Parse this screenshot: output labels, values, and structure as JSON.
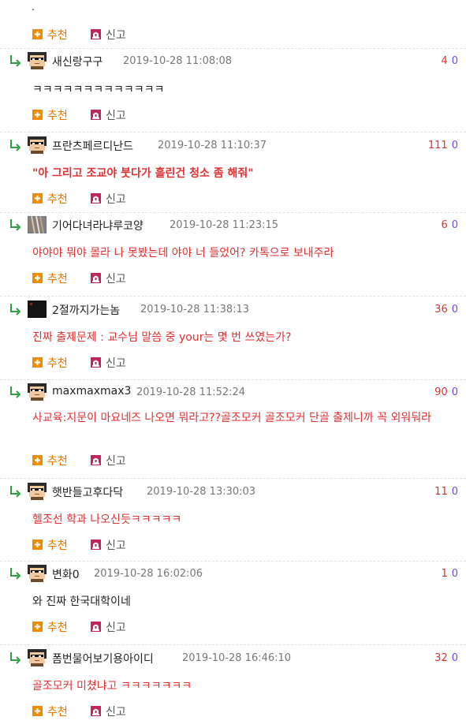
{
  "actions": {
    "recommend_label": "추천",
    "report_label": "신고"
  },
  "icons": {
    "reply": "reply-arrow-icon",
    "recommend": "plus-box-icon",
    "report": "siren-icon",
    "avatar": "pixel-avatar-icon"
  },
  "colors": {
    "red_text": "#e03131",
    "vote_down": "#7048e8",
    "recommend_orange": "#f08c00",
    "report_magenta": "#c2255c"
  },
  "first_comment": {
    "body": "."
  },
  "comments": [
    {
      "nick": "새신랑구구",
      "date": "2019-10-28 11:08:08",
      "up": "4",
      "down": "0",
      "body": "ㅋㅋㅋㅋㅋㅋㅋㅋㅋㅋㅋㅋㅋ",
      "body_style": "black",
      "avatar": "pixel"
    },
    {
      "nick": "프란츠페르디난드",
      "date": "2019-10-28 11:10:37",
      "up": "111",
      "down": "0",
      "body": "\"아 그리고 조교야 붓다가 흘린건 청소 좀 해줘\"",
      "body_style": "red-bold",
      "avatar": "pixel"
    },
    {
      "nick": "기어다녀라냐루코양",
      "date": "2019-10-28 11:23:15",
      "up": "6",
      "down": "0",
      "body": "야야야 뭐야 몰라 나 못봤는데 야야 너 들었어? 카톡으로 보내주라",
      "body_style": "red",
      "avatar": "photo-grey"
    },
    {
      "nick": "2절까지가는놈",
      "date": "2019-10-28 11:38:13",
      "up": "36",
      "down": "0",
      "body": "진짜 출제문제 : 교수님 말씀 중 your는 몇 번 쓰였는가?",
      "body_style": "red",
      "avatar": "photo-dark"
    },
    {
      "nick": "maxmaxmax3",
      "date": "2019-10-28 11:52:24",
      "up": "90",
      "down": "0",
      "body": "사교육:지문이 마요네즈 나오면 뭐라고??골조모커 골조모커 단골 출제니까 꼭 외워둬라",
      "body_style": "red",
      "avatar": "pixel"
    },
    {
      "nick": "햇반들고후다닥",
      "date": "2019-10-28 13:30:03",
      "up": "11",
      "down": "0",
      "body": "헬조선 학과 나오신듯ㅋㅋㅋㅋㅋ",
      "body_style": "red",
      "avatar": "pixel"
    },
    {
      "nick": "변화0",
      "date": "2019-10-28 16:02:06",
      "up": "1",
      "down": "0",
      "body": "와 진짜 한국대학이네",
      "body_style": "black",
      "avatar": "pixel"
    },
    {
      "nick": "폼번물어보기용아이디",
      "date": "2019-10-28 16:46:10",
      "up": "32",
      "down": "0",
      "body": "골조모커 미쳤냐고 ㅋㅋㅋㅋㅋㅋㅋ",
      "body_style": "red",
      "avatar": "pixel"
    }
  ]
}
